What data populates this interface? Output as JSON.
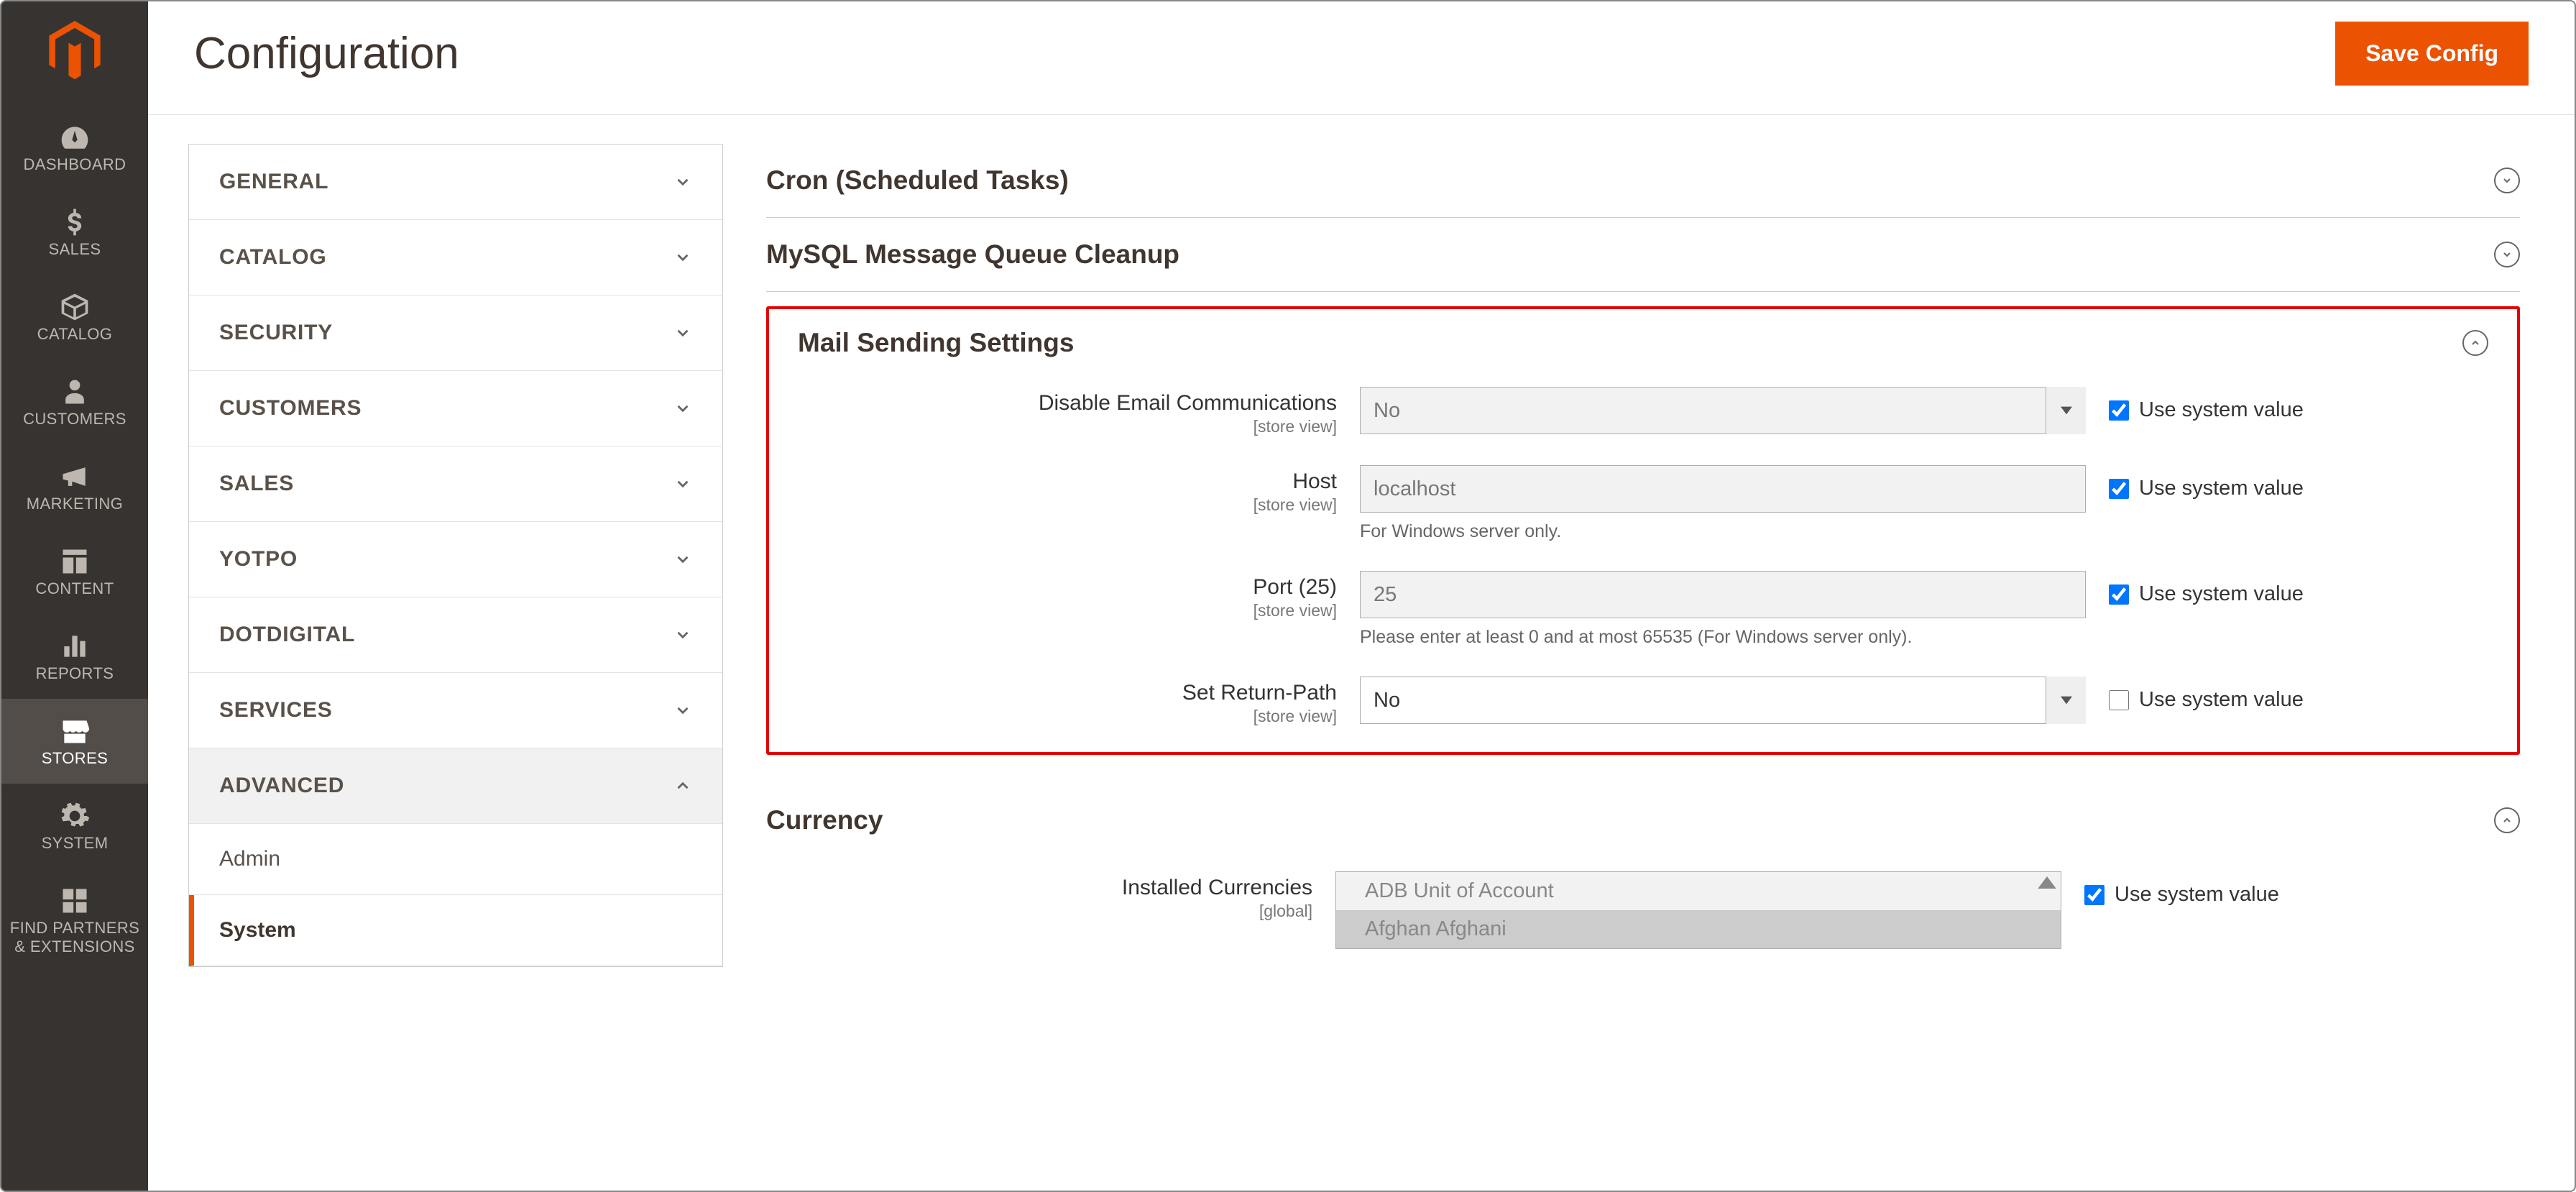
{
  "header": {
    "title": "Configuration",
    "save_label": "Save Config"
  },
  "nav": {
    "items": [
      {
        "label": "DASHBOARD",
        "icon": "gauge"
      },
      {
        "label": "SALES",
        "icon": "dollar"
      },
      {
        "label": "CATALOG",
        "icon": "box"
      },
      {
        "label": "CUSTOMERS",
        "icon": "person"
      },
      {
        "label": "MARKETING",
        "icon": "megaphone"
      },
      {
        "label": "CONTENT",
        "icon": "layout"
      },
      {
        "label": "REPORTS",
        "icon": "bars"
      },
      {
        "label": "STORES",
        "icon": "storefront",
        "active": true
      },
      {
        "label": "SYSTEM",
        "icon": "gear"
      },
      {
        "label": "FIND PARTNERS & EXTENSIONS",
        "icon": "blocks"
      }
    ]
  },
  "tabs": [
    {
      "label": "GENERAL",
      "expanded": false
    },
    {
      "label": "CATALOG",
      "expanded": false
    },
    {
      "label": "SECURITY",
      "expanded": false
    },
    {
      "label": "CUSTOMERS",
      "expanded": false
    },
    {
      "label": "SALES",
      "expanded": false
    },
    {
      "label": "YOTPO",
      "expanded": false
    },
    {
      "label": "DOTDIGITAL",
      "expanded": false
    },
    {
      "label": "SERVICES",
      "expanded": false
    },
    {
      "label": "ADVANCED",
      "expanded": true,
      "children": [
        {
          "label": "Admin",
          "selected": false
        },
        {
          "label": "System",
          "selected": true
        }
      ]
    }
  ],
  "sections": {
    "cron": {
      "title": "Cron (Scheduled Tasks)",
      "open": false
    },
    "mysql": {
      "title": "MySQL Message Queue Cleanup",
      "open": false
    },
    "mail": {
      "title": "Mail Sending Settings",
      "open": true,
      "fields": {
        "disable": {
          "label": "Disable Email Communications",
          "scope": "[store view]",
          "value": "No",
          "use_system": true
        },
        "host": {
          "label": "Host",
          "scope": "[store view]",
          "value": "localhost",
          "use_system": true,
          "note": "For Windows server only."
        },
        "port": {
          "label": "Port (25)",
          "scope": "[store view]",
          "value": "25",
          "use_system": true,
          "note": "Please enter at least 0 and at most 65535 (For Windows server only)."
        },
        "return_path": {
          "label": "Set Return-Path",
          "scope": "[store view]",
          "value": "No",
          "use_system": false
        }
      }
    },
    "currency": {
      "title": "Currency",
      "open": true,
      "fields": {
        "installed": {
          "label": "Installed Currencies",
          "scope": "[global]",
          "options": [
            "ADB Unit of Account",
            "Afghan Afghani"
          ],
          "use_system": true
        }
      }
    }
  },
  "common": {
    "use_system_label": "Use system value"
  }
}
